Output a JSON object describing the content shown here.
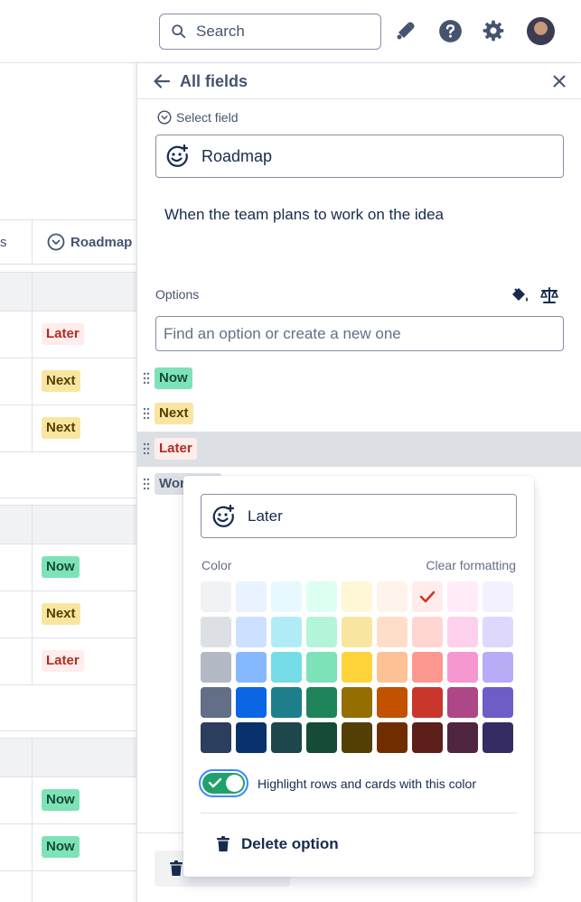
{
  "topbar": {
    "search_placeholder": "Search",
    "icons": [
      "search-icon",
      "notification-icon",
      "help-icon",
      "settings-icon",
      "avatar"
    ]
  },
  "table": {
    "header_left_fragment": "s",
    "header_roadmap": "Roadmap",
    "rows": [
      {
        "tag": "Later",
        "kind": "later"
      },
      {
        "tag": "Next",
        "kind": "next"
      },
      {
        "tag": "Next",
        "kind": "next"
      },
      {
        "tag": "Now",
        "kind": "now"
      },
      {
        "tag": "Next",
        "kind": "next"
      },
      {
        "tag": "Later",
        "kind": "later"
      },
      {
        "tag": "Now",
        "kind": "now"
      },
      {
        "tag": "Now",
        "kind": "now"
      }
    ]
  },
  "panel": {
    "title": "All fields",
    "select_field_label": "Select field",
    "field_name": "Roadmap",
    "description": "When the team plans to work on the idea",
    "options_label": "Options",
    "find_placeholder": "Find an option or create a new one",
    "options": [
      {
        "label": "Now",
        "kind": "now"
      },
      {
        "label": "Next",
        "kind": "next"
      },
      {
        "label": "Later",
        "kind": "later"
      },
      {
        "label": "Wor",
        "kind": "working"
      }
    ]
  },
  "popup": {
    "option_name": "Later",
    "color_label": "Color",
    "clear_label": "Clear formatting",
    "swatches": [
      "#f1f2f4",
      "#e9f2ff",
      "#e7f9ff",
      "#dcfff1",
      "#fff7d6",
      "#fff3eb",
      "#ffeceb",
      "#ffecf8",
      "#f3f0ff",
      "#dcdfe4",
      "#cce0ff",
      "#b1ecf6",
      "#b4f4d8",
      "#f8e6a0",
      "#fedec8",
      "#ffd5d2",
      "#fdd0ec",
      "#dfd8fd",
      "#b3b9c4",
      "#85b8ff",
      "#75dbe6",
      "#7ee2b8",
      "#ffd43b",
      "#fec195",
      "#fd9891",
      "#f797d2",
      "#b8acf6",
      "#626f86",
      "#0c66e4",
      "#1d7f8c",
      "#1f845a",
      "#946f00",
      "#c25100",
      "#c9372c",
      "#ae4787",
      "#6e5dc6",
      "#2c3e5d",
      "#09326c",
      "#1d474c",
      "#164b35",
      "#533f04",
      "#702e00",
      "#5d1f1a",
      "#50253f",
      "#352c63"
    ],
    "selected_swatch_index": 6,
    "toggle_label": "Highlight rows and cards with this color",
    "toggle_on": true,
    "delete_label": "Delete option"
  }
}
